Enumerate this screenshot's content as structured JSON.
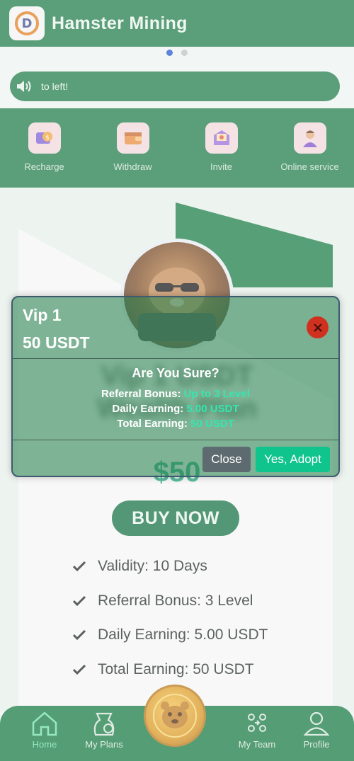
{
  "header": {
    "title": "Hamster Mining",
    "logo_letter": "D"
  },
  "carousel": {
    "dots": 2,
    "active_index": 0
  },
  "marquee": {
    "text": "to left!"
  },
  "actions": [
    {
      "label": "Recharge",
      "icon": "recharge-icon"
    },
    {
      "label": "Withdraw",
      "icon": "wallet-icon"
    },
    {
      "label": "Invite",
      "icon": "invite-icon"
    },
    {
      "label": "Online service",
      "icon": "support-agent-icon"
    }
  ],
  "product": {
    "price": "$50",
    "buy_label": "BUY NOW",
    "features": [
      "Validity: 10 Days",
      "Referral Bonus: 3 Level",
      "Daily Earning: 5.00 USDT",
      "Total Earning: 50 USDT"
    ]
  },
  "modal": {
    "plan": "Vip 1",
    "amount": "50 USDT",
    "question": "Are You Sure?",
    "lines": [
      {
        "label": "Referral Bonus:",
        "value": "Up to 3 Level"
      },
      {
        "label": "Daily Earning:",
        "value": "5.00 USDT"
      },
      {
        "label": "Total Earning:",
        "value": "50 USDT"
      }
    ],
    "close_label": "Close",
    "confirm_label": "Yes, Adopt"
  },
  "nav": {
    "items": [
      {
        "label": "Home",
        "icon": "home-icon",
        "active": true
      },
      {
        "label": "My Plans",
        "icon": "plans-icon",
        "active": false
      },
      {
        "label": "My Team",
        "icon": "team-icon",
        "active": false
      },
      {
        "label": "Profile",
        "icon": "profile-icon",
        "active": false
      }
    ]
  },
  "colors": {
    "brand_green": "#1b7a46",
    "accent_teal": "#10c48d",
    "close_red": "#d0311f"
  }
}
